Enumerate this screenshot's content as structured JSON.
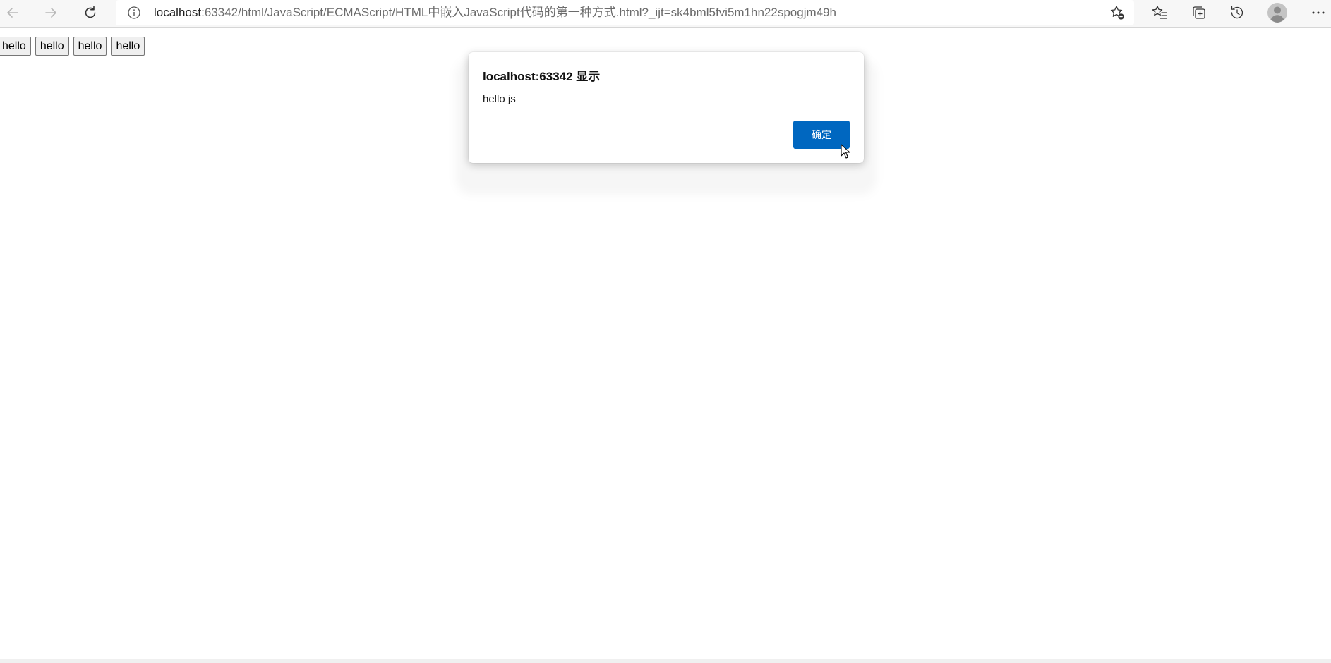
{
  "browser": {
    "url_host": "localhost",
    "url_rest": ":63342/html/JavaScript/ECMAScript/HTML中嵌入JavaScript代码的第一种方式.html?_ijt=sk4bml5fvi5m1hn22spogjm49h",
    "icons": {
      "back": "back-arrow-icon",
      "forward": "forward-arrow-icon",
      "refresh": "refresh-icon",
      "site_info": "info-icon",
      "add_favorite": "star-plus-icon",
      "favorites": "favorites-icon",
      "collections": "collections-icon",
      "history": "history-icon",
      "profile": "profile-avatar-icon",
      "menu": "more-menu-icon"
    }
  },
  "page": {
    "buttons": [
      "hello",
      "hello",
      "hello",
      "hello"
    ]
  },
  "dialog": {
    "title": "localhost:63342 显示",
    "message": "hello js",
    "ok_label": "确定",
    "accent_color": "#0067c0"
  }
}
